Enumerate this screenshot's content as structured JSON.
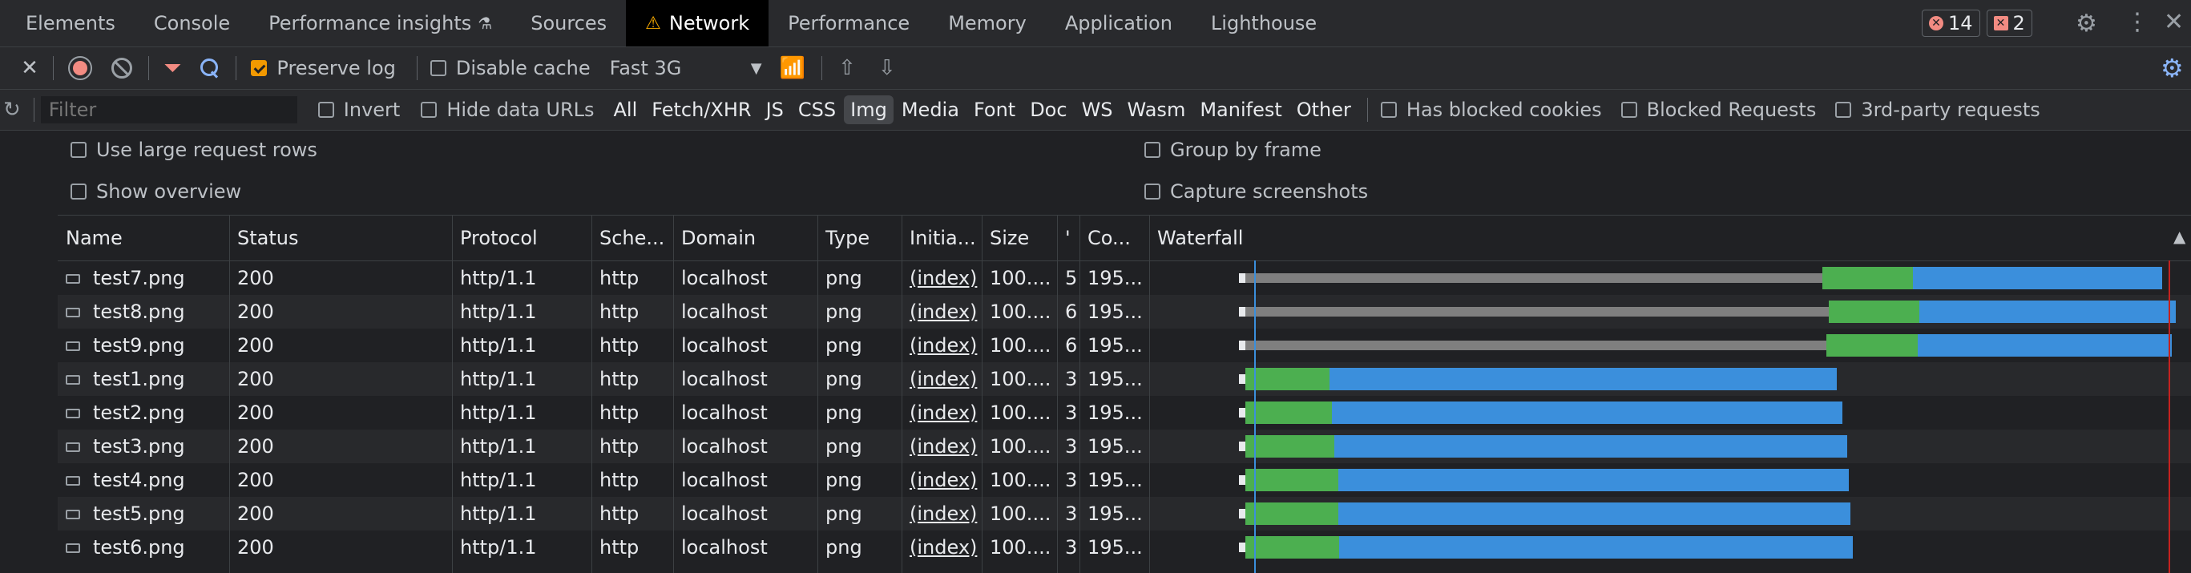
{
  "tabs": [
    {
      "label": "Elements"
    },
    {
      "label": "Console"
    },
    {
      "label": "Performance insights",
      "badge": "⚗"
    },
    {
      "label": "Sources"
    },
    {
      "label": "Network",
      "active": true,
      "warning": "⚠"
    },
    {
      "label": "Performance"
    },
    {
      "label": "Memory"
    },
    {
      "label": "Application"
    },
    {
      "label": "Lighthouse"
    }
  ],
  "status": {
    "errors": "14",
    "issues": "2"
  },
  "toolbar": {
    "preserve_log": "Preserve log",
    "disable_cache": "Disable cache",
    "throttle": "Fast 3G"
  },
  "filter": {
    "placeholder": "Filter",
    "invert": "Invert",
    "hide_data_urls": "Hide data URLs",
    "types": [
      "All",
      "Fetch/XHR",
      "JS",
      "CSS",
      "Img",
      "Media",
      "Font",
      "Doc",
      "WS",
      "Wasm",
      "Manifest",
      "Other"
    ],
    "active_type": "Img",
    "has_blocked_cookies": "Has blocked cookies",
    "blocked_requests": "Blocked Requests",
    "third_party": "3rd-party requests"
  },
  "settings": {
    "large_rows": "Use large request rows",
    "show_overview": "Show overview",
    "group_by_frame": "Group by frame",
    "capture_screenshots": "Capture screenshots"
  },
  "table": {
    "headers": [
      "Name",
      "Status",
      "Protocol",
      "Sche...",
      "Domain",
      "Type",
      "Initia...",
      "Size",
      "'",
      "Co...",
      "Waterfall"
    ],
    "rows": [
      {
        "name": "test7.png",
        "status": "200",
        "protocol": "http/1.1",
        "scheme": "http",
        "domain": "localhost",
        "type": "png",
        "initiator": "(index)",
        "size": "100....",
        "time": "5.",
        "content": "195...",
        "wait": 0.615,
        "dl1": 0.097,
        "dl2": 0.266
      },
      {
        "name": "test8.png",
        "status": "200",
        "protocol": "http/1.1",
        "scheme": "http",
        "domain": "localhost",
        "type": "png",
        "initiator": "(index)",
        "size": "100....",
        "time": "6.",
        "content": "195...",
        "wait": 0.622,
        "dl1": 0.097,
        "dl2": 0.273
      },
      {
        "name": "test9.png",
        "status": "200",
        "protocol": "http/1.1",
        "scheme": "http",
        "domain": "localhost",
        "type": "png",
        "initiator": "(index)",
        "size": "100....",
        "time": "6.",
        "content": "195...",
        "wait": 0.62,
        "dl1": 0.097,
        "dl2": 0.271
      },
      {
        "name": "test1.png",
        "status": "200",
        "protocol": "http/1.1",
        "scheme": "http",
        "domain": "localhost",
        "type": "png",
        "initiator": "(index)",
        "size": "100....",
        "time": "3.",
        "content": "195...",
        "wait": 0.0,
        "dl1": 0.09,
        "dl2": 0.541
      },
      {
        "name": "test2.png",
        "status": "200",
        "protocol": "http/1.1",
        "scheme": "http",
        "domain": "localhost",
        "type": "png",
        "initiator": "(index)",
        "size": "100....",
        "time": "3.",
        "content": "195...",
        "wait": 0.0,
        "dl1": 0.092,
        "dl2": 0.545
      },
      {
        "name": "test3.png",
        "status": "200",
        "protocol": "http/1.1",
        "scheme": "http",
        "domain": "localhost",
        "type": "png",
        "initiator": "(index)",
        "size": "100....",
        "time": "3.",
        "content": "195...",
        "wait": 0.0,
        "dl1": 0.095,
        "dl2": 0.547
      },
      {
        "name": "test4.png",
        "status": "200",
        "protocol": "http/1.1",
        "scheme": "http",
        "domain": "localhost",
        "type": "png",
        "initiator": "(index)",
        "size": "100....",
        "time": "3.",
        "content": "195...",
        "wait": 0.0,
        "dl1": 0.099,
        "dl2": 0.545
      },
      {
        "name": "test5.png",
        "status": "200",
        "protocol": "http/1.1",
        "scheme": "http",
        "domain": "localhost",
        "type": "png",
        "initiator": "(index)",
        "size": "100....",
        "time": "3.",
        "content": "195...",
        "wait": 0.0,
        "dl1": 0.099,
        "dl2": 0.546
      },
      {
        "name": "test6.png",
        "status": "200",
        "protocol": "http/1.1",
        "scheme": "http",
        "domain": "localhost",
        "type": "png",
        "initiator": "(index)",
        "size": "100....",
        "time": "3.",
        "content": "195...",
        "wait": 0.0,
        "dl1": 0.1,
        "dl2": 0.548
      }
    ]
  },
  "colors": {
    "waiting": "#7f7f7f",
    "green": "#4caf50",
    "blue": "#3b8fdc",
    "accent": "#8ab4f8",
    "error": "#f28b82"
  }
}
